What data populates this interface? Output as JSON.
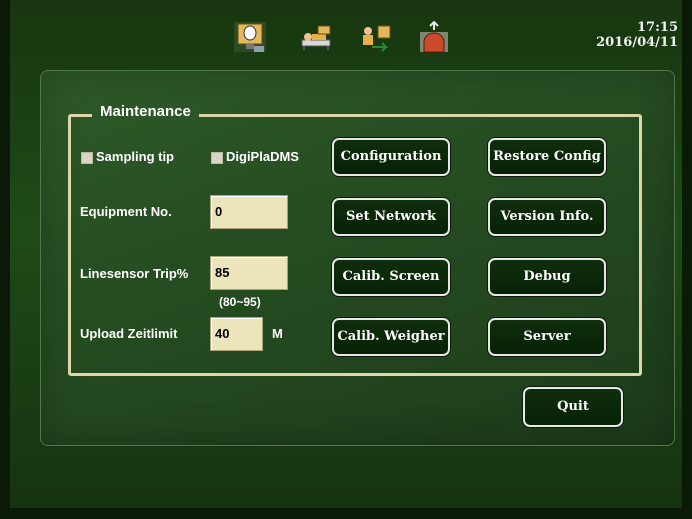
{
  "status": {
    "time": "17:15",
    "date": "2016/04/11"
  },
  "toolbar": {
    "icons": [
      "sampling-station-icon",
      "bed-patient-icon",
      "transfer-icon",
      "upload-container-icon"
    ]
  },
  "maintenance": {
    "title": "Maintenance",
    "checkboxes": [
      {
        "label": "Sampling tip",
        "checked": false
      },
      {
        "label": "DigiPlaDMS",
        "checked": false
      }
    ],
    "fields": {
      "equipment_no": {
        "label": "Equipment No.",
        "value": "0"
      },
      "linesensor_trip": {
        "label": "Linesensor Trip%",
        "value": "85",
        "range": "(80~95)"
      },
      "upload_limit": {
        "label": "Upload Zeitlimit",
        "value": "40",
        "unit": "M"
      }
    },
    "buttons": {
      "configuration": "Configuration",
      "restore_config": "Restore Config",
      "set_network": "Set Network",
      "version_info": "Version Info.",
      "calib_screen": "Calib. Screen",
      "debug": "Debug",
      "calib_weigher": "Calib. Weigher",
      "server": "Server",
      "quit": "Quit"
    }
  },
  "colors": {
    "field_bg": "#ece4ba",
    "group_border": "#ddd6a8",
    "button_bg": "#0f2e0d"
  }
}
